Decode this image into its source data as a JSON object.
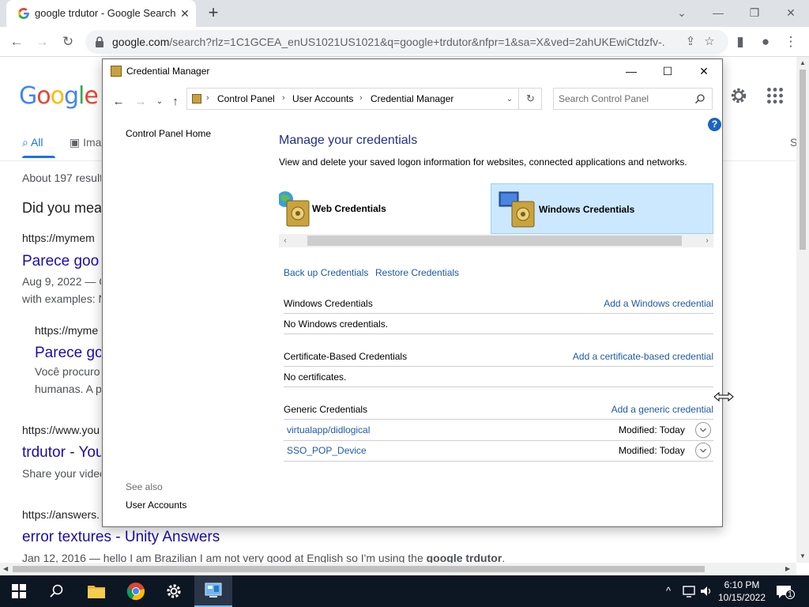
{
  "browser": {
    "tab_title": "google trdutor - Google Search",
    "url_host": "google.com",
    "url_rest": "/search?rlz=1C1GCEA_enUS1021US1021&q=google+trdutor&nfpr=1&sa=X&ved=2ahUKEwiCtdzfv-..."
  },
  "google": {
    "logo": "Google",
    "tab_all": "All",
    "tab_images": "Ima",
    "tab_s": "S",
    "results_count": "About 197 result",
    "did_you_mean": "Did you mear",
    "r1_cite": "https://mymem",
    "r1_title": "Parece goo",
    "r1_date": "Aug 9, 2022 — C",
    "r1_snip": "with examples: N",
    "r2_cite": "https://myme",
    "r2_title": "Parece go",
    "r2_snip1": "Você procuro",
    "r2_snip2": "humanas. A p",
    "r3_cite": "https://www.you",
    "r3_title": "trdutor - You",
    "r3_snip": "Share your video",
    "r4_cite": "https://answers.",
    "r4_title": "error textures - Unity Answers",
    "r4_snip_pre": "Jan 12, 2016 — hello I am Brazilian I am not very good at English so I'm using the ",
    "r4_snip_bold": "google trdutor",
    "r4_snip_post": "."
  },
  "credman": {
    "window_title": "Credential Manager",
    "breadcrumb": [
      "Control Panel",
      "User Accounts",
      "Credential Manager"
    ],
    "search_placeholder": "Search Control Panel",
    "help": "?",
    "left_home": "Control Panel Home",
    "see_also": "See also",
    "see_also_link": "User Accounts",
    "heading": "Manage your credentials",
    "subtext": "View and delete your saved logon information for websites, connected applications and networks.",
    "web_credentials": "Web Credentials",
    "windows_credentials": "Windows Credentials",
    "backup": "Back up Credentials",
    "restore": "Restore Credentials",
    "sections": {
      "windows": {
        "title": "Windows Credentials",
        "add": "Add a Windows credential",
        "empty": "No Windows credentials."
      },
      "certificate": {
        "title": "Certificate-Based Credentials",
        "add": "Add a certificate-based credential",
        "empty": "No certificates."
      },
      "generic": {
        "title": "Generic Credentials",
        "add": "Add a generic credential",
        "items": [
          {
            "name": "virtualapp/didlogical",
            "modified": "Modified:  Today"
          },
          {
            "name": "SSO_POP_Device",
            "modified": "Modified:  Today"
          }
        ]
      }
    }
  },
  "taskbar": {
    "time": "6:10 PM",
    "date": "10/15/2022",
    "notification_count": "1"
  },
  "colors": {
    "accent_blue": "#1a73e8",
    "link_blue": "#1e5aa6",
    "heading_blue": "#1e3287",
    "selected_bg": "#cce8ff",
    "taskbar": "#0d1623"
  }
}
